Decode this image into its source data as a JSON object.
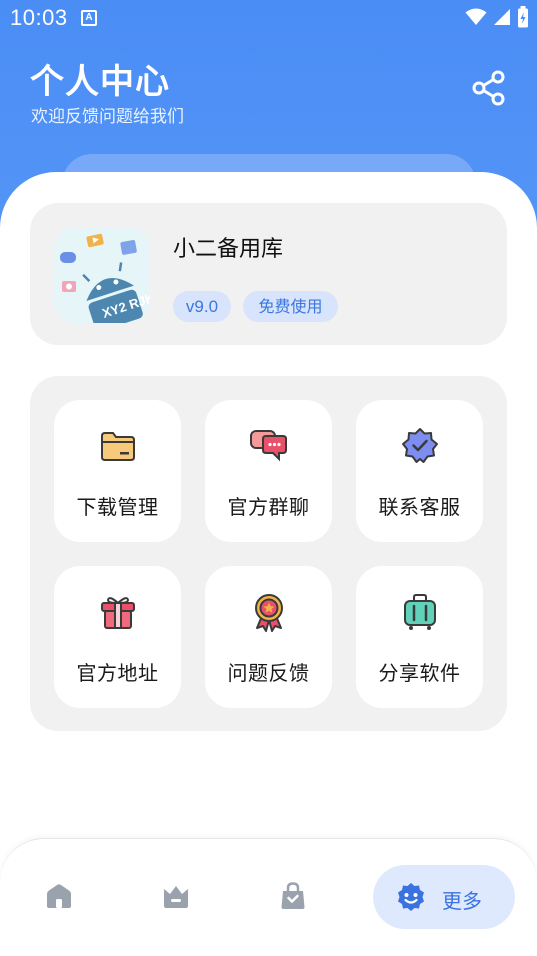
{
  "status_bar": {
    "time": "10:03",
    "indicator": "A"
  },
  "header": {
    "title": "个人中心",
    "subtitle": "欢迎反馈问题给我们",
    "share_icon": "share-icon"
  },
  "app_card": {
    "logo_text": "XY2 RJK",
    "name": "小二备用库",
    "version": "v9.0",
    "license": "免费使用"
  },
  "menu": {
    "items": [
      {
        "label": "下载管理",
        "icon": "folder-icon"
      },
      {
        "label": "官方群聊",
        "icon": "chat-bubbles-icon"
      },
      {
        "label": "联系客服",
        "icon": "verified-badge-icon"
      },
      {
        "label": "官方地址",
        "icon": "gift-icon"
      },
      {
        "label": "问题反馈",
        "icon": "medal-icon"
      },
      {
        "label": "分享软件",
        "icon": "suitcase-icon"
      }
    ]
  },
  "bottom_nav": {
    "items": [
      {
        "icon": "home-icon"
      },
      {
        "icon": "crown-icon"
      },
      {
        "icon": "shopping-bag-icon"
      },
      {
        "icon": "settings-face-icon",
        "label": "更多",
        "active": true
      }
    ]
  },
  "colors": {
    "primary": "#4a8df5",
    "card_bg": "#f1f1f1",
    "tag_bg": "#d8e4fb",
    "tag_text": "#3b76e2",
    "nav_active_bg": "#dfe9fd"
  }
}
